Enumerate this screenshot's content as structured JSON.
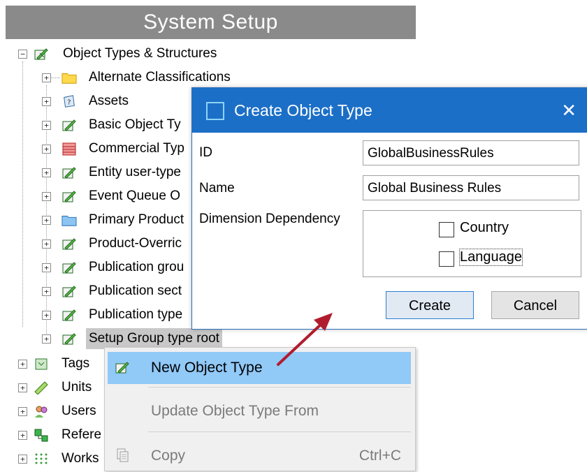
{
  "header": {
    "title": "System Setup"
  },
  "tree": {
    "root_label": "Object Types & Structures",
    "children": [
      "Alternate Classifications",
      "Assets",
      "Basic Object Ty",
      "Commercial Typ",
      "Entity user-type",
      "Event Queue O",
      "Primary Product",
      "Product-Overric",
      "Publication grou",
      "Publication sect",
      "Publication type",
      "Setup Group type root"
    ],
    "siblings": [
      "Tags",
      "Units",
      "Users",
      "Refere",
      "Works"
    ]
  },
  "context_menu": {
    "items": [
      {
        "label": "New Object Type",
        "shortcut": ""
      },
      {
        "label": "Update Object Type From",
        "shortcut": ""
      },
      {
        "label": "Copy",
        "shortcut": "Ctrl+C"
      }
    ]
  },
  "dialog": {
    "title": "Create Object Type",
    "close_glyph": "✕",
    "id_label": "ID",
    "id_value": "GlobalBusinessRules",
    "name_label": "Name",
    "name_value": "Global Business Rules",
    "dimension_label": "Dimension Dependency",
    "options": [
      "Country",
      "Language"
    ],
    "create_label": "Create",
    "cancel_label": "Cancel"
  },
  "colors": {
    "title_bar": "#1c6fc7",
    "menu_highlight": "#91c9f7",
    "arrow": "#b01c2e",
    "header_bg": "#8a8a8a"
  }
}
